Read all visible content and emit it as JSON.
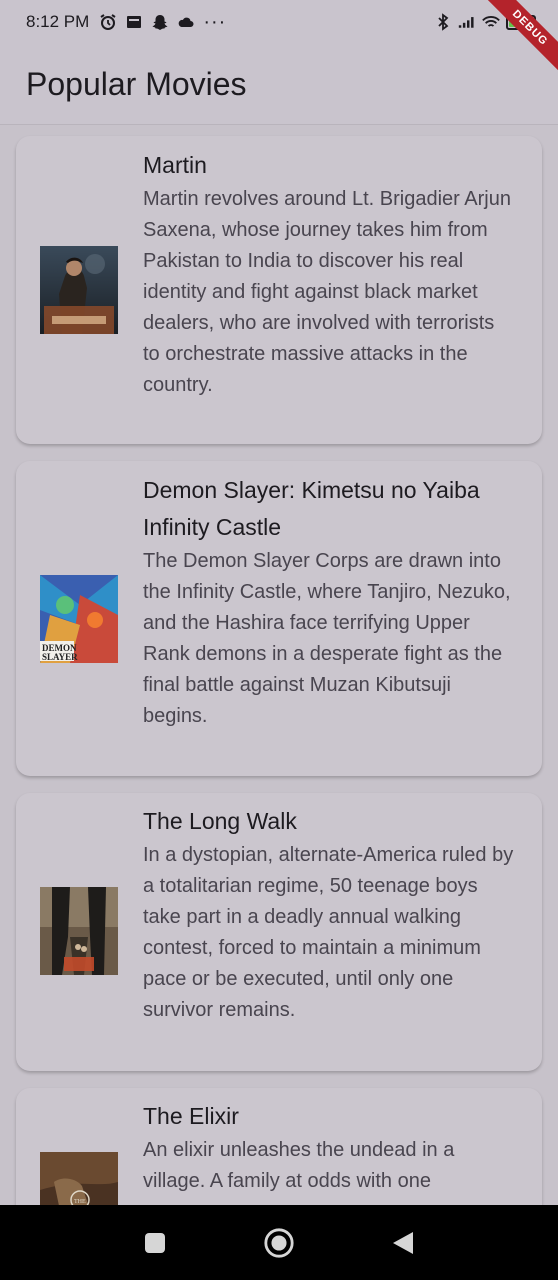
{
  "status_bar": {
    "time": "8:12 PM",
    "icons_left": [
      "alarm-icon",
      "news-icon",
      "snapchat-icon",
      "cloud-icon",
      "more-dots-icon"
    ],
    "more": "···",
    "icons_right": [
      "bluetooth-icon",
      "signal-icon",
      "wifi-icon",
      "battery-icon"
    ],
    "battery_level": "46"
  },
  "debug_banner": "DEBUG",
  "app_bar": {
    "title": "Popular Movies"
  },
  "movies": [
    {
      "title": "Martin",
      "overview": "Martin revolves around Lt. Brigadier Arjun Saxena, whose journey takes him from Pakistan to India to discover his real identity and fight against black market dealers, who are involved with terrorists to orchestrate massive attacks in the country."
    },
    {
      "title": "Demon Slayer: Kimetsu no Yaiba Infinity Castle",
      "overview": "The Demon Slayer Corps are drawn into the Infinity Castle, where Tanjiro, Nezuko, and the Hashira face terrifying Upper Rank demons in a desperate fight as the final battle against Muzan Kibutsuji begins."
    },
    {
      "title": "The Long Walk",
      "overview": "In a dystopian, alternate-America ruled by a totalitarian regime, 50 teenage boys take part in a deadly annual walking contest, forced to maintain a minimum pace or be executed, until only one survivor remains."
    },
    {
      "title": "The Elixir",
      "overview": "An elixir unleashes the undead in a village. A family at odds with one"
    }
  ],
  "nav_bar": {
    "buttons": [
      "recents-button",
      "home-button",
      "back-button"
    ]
  }
}
